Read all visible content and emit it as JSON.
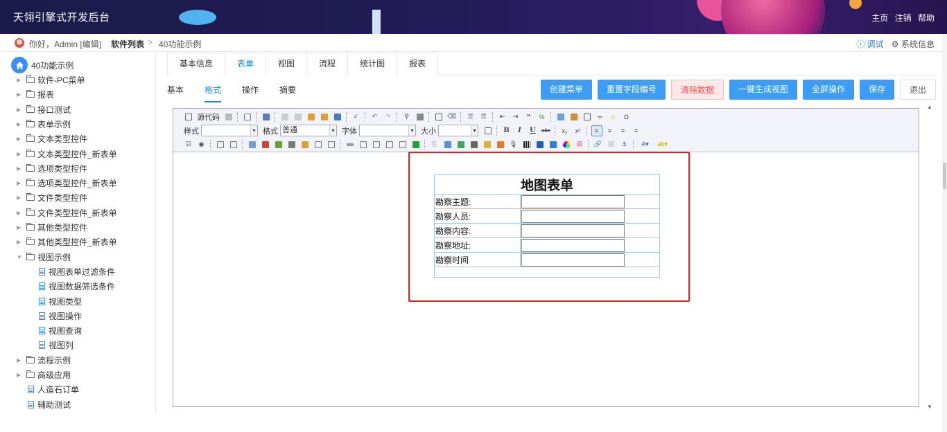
{
  "app": {
    "title": "天翎引擎式开发后台"
  },
  "header_nav": [
    "主页",
    "注销",
    "帮助"
  ],
  "breadcrumb": {
    "greeting": "你好，Admin [编辑]",
    "level1": "软件列表",
    "separator": ">",
    "level2": "40功能示例"
  },
  "top_right": {
    "debug": "ⓘ 调试",
    "system": "⚙ 系统信息"
  },
  "sidebar": {
    "root": "40功能示例",
    "items": [
      {
        "label": "软件-PC菜单",
        "type": "folder"
      },
      {
        "label": "报表",
        "type": "folder"
      },
      {
        "label": "接口测试",
        "type": "folder"
      },
      {
        "label": "表单示例",
        "type": "folder"
      },
      {
        "label": "文本类型控件",
        "type": "folder"
      },
      {
        "label": "文本类型控件_新表单",
        "type": "folder"
      },
      {
        "label": "选项类型控件",
        "type": "folder"
      },
      {
        "label": "选项类型控件_新表单",
        "type": "folder"
      },
      {
        "label": "文件类型控件",
        "type": "folder"
      },
      {
        "label": "文件类型控件_新表单",
        "type": "folder"
      },
      {
        "label": "其他类型控件",
        "type": "folder"
      },
      {
        "label": "其他类型控件_新表单",
        "type": "folder"
      },
      {
        "label": "视图示例",
        "type": "folder-open"
      },
      {
        "label": "视图表单过滤条件",
        "type": "child"
      },
      {
        "label": "视图数据筛选条件",
        "type": "child"
      },
      {
        "label": "视图类型",
        "type": "child"
      },
      {
        "label": "视图操作",
        "type": "child"
      },
      {
        "label": "视图查询",
        "type": "child"
      },
      {
        "label": "视图列",
        "type": "child"
      },
      {
        "label": "流程示例",
        "type": "folder"
      },
      {
        "label": "高级应用",
        "type": "folder"
      },
      {
        "label": "人造石订单",
        "type": "doc"
      },
      {
        "label": "辅助测试",
        "type": "doc"
      }
    ]
  },
  "tabs": [
    "基本信息",
    "表单",
    "视图",
    "流程",
    "统计图",
    "报表"
  ],
  "subtabs": [
    "基本",
    "格式",
    "操作",
    "摘要"
  ],
  "buttons": [
    "创建菜单",
    "重置字段编号",
    "清除数据",
    "一键生成视图",
    "全屏操作",
    "保存",
    "退出"
  ],
  "toolbar": {
    "source": "源代码",
    "style_label": "样式",
    "format_label": "格式",
    "format_value": "普通",
    "font_label": "字体",
    "size_label": "大小",
    "style_value": "",
    "font_value": "",
    "size_value": ""
  },
  "form": {
    "title": "地图表单",
    "fields": [
      "勘察主题:",
      "勘察人员:",
      "勘察内容:",
      "勘察地址:",
      "勘察时间"
    ]
  }
}
